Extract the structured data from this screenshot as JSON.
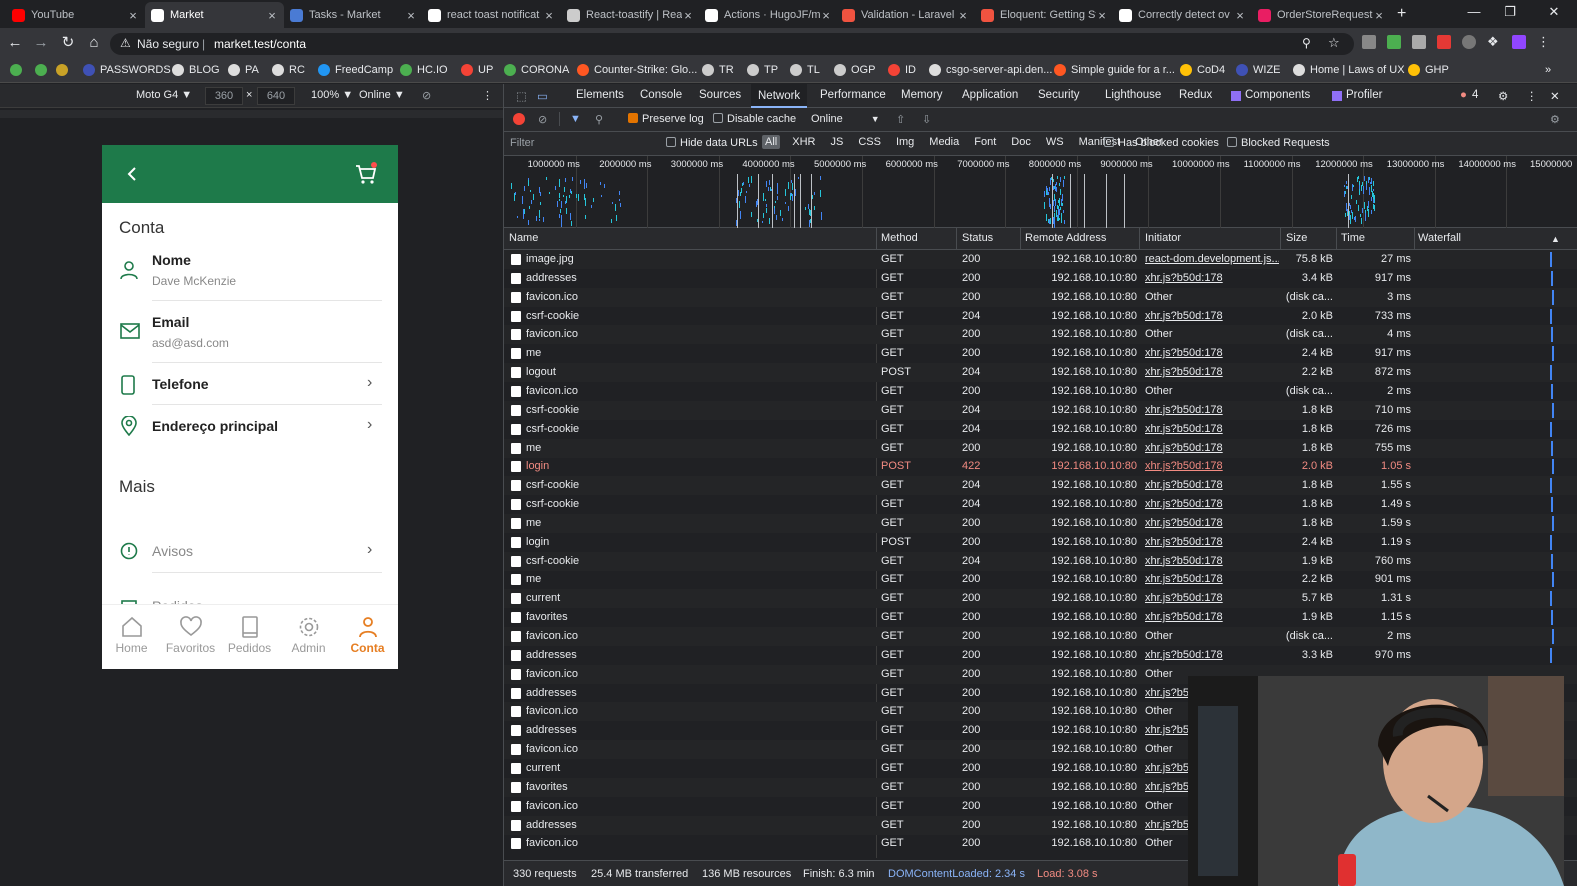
{
  "browser": {
    "tabs": [
      {
        "title": "YouTube",
        "color": "#ff0000"
      },
      {
        "title": "Market",
        "color": "#ffffff",
        "active": true
      },
      {
        "title": "Tasks - Market",
        "color": "#4a7bd4"
      },
      {
        "title": "react toast notificat",
        "color": "#ffffff"
      },
      {
        "title": "React-toastify | Rea",
        "color": "#cccccc"
      },
      {
        "title": "Actions · HugoJF/m",
        "color": "#ffffff"
      },
      {
        "title": "Validation - Laravel",
        "color": "#f05340"
      },
      {
        "title": "Eloquent: Getting St",
        "color": "#f05340"
      },
      {
        "title": "Correctly detect ov",
        "color": "#ffffff"
      },
      {
        "title": "OrderStoreRequest",
        "color": "#e91e63"
      }
    ],
    "security_label": "Não seguro",
    "url": "market.test/conta",
    "bookmarks": [
      {
        "label": "",
        "color": "#4caf50"
      },
      {
        "label": "",
        "color": "#4caf50"
      },
      {
        "label": "",
        "color": "#c9a227"
      },
      {
        "label": "PASSWORDS",
        "color": "#3f51b5"
      },
      {
        "label": "BLOG",
        "color": "#dddddd"
      },
      {
        "label": "PA",
        "color": "#dddddd"
      },
      {
        "label": "RC",
        "color": "#dddddd"
      },
      {
        "label": "FreedCamp",
        "color": "#2196f3"
      },
      {
        "label": "HC.IO",
        "color": "#4caf50"
      },
      {
        "label": "UP",
        "color": "#f44336"
      },
      {
        "label": "CORONA",
        "color": "#4caf50"
      },
      {
        "label": "Counter-Strike: Glo...",
        "color": "#ff5722"
      },
      {
        "label": "TR",
        "color": "#cccccc"
      },
      {
        "label": "TP",
        "color": "#cccccc"
      },
      {
        "label": "TL",
        "color": "#cccccc"
      },
      {
        "label": "OGP",
        "color": "#cccccc"
      },
      {
        "label": "ID",
        "color": "#f44336"
      },
      {
        "label": "csgo-server-api.den...",
        "color": "#dddddd"
      },
      {
        "label": "Simple guide for a r...",
        "color": "#ff5722"
      },
      {
        "label": "CoD4",
        "color": "#ffc107"
      },
      {
        "label": "WIZE",
        "color": "#3f51b5"
      },
      {
        "label": "Home | Laws of UX",
        "color": "#dddddd"
      },
      {
        "label": "GHP",
        "color": "#ffc107"
      }
    ]
  },
  "device_toolbar": {
    "device": "Moto G4 ▼",
    "width": "360",
    "times": "×",
    "height": "640",
    "zoom": "100% ▼",
    "network": "Online ▼"
  },
  "app": {
    "section_title": "Conta",
    "items": [
      {
        "label": "Nome",
        "sub": "Dave McKenzie",
        "icon": "user-icon"
      },
      {
        "label": "Email",
        "sub": "asd@asd.com",
        "icon": "mail-icon"
      },
      {
        "label": "Telefone",
        "icon": "phone-icon"
      },
      {
        "label": "Endereço principal",
        "icon": "map-pin-icon"
      }
    ],
    "more_title": "Mais",
    "more_items": [
      {
        "label": "Avisos",
        "icon": "alert-circle-icon"
      },
      {
        "label": "Pedidos",
        "icon": "bag-icon"
      }
    ],
    "bottom_nav": [
      "Home",
      "Favoritos",
      "Pedidos",
      "Admin",
      "Conta"
    ],
    "accent": "#1e7a4a",
    "active_color": "#e67e22"
  },
  "devtools": {
    "tabs": [
      "Elements",
      "Console",
      "Sources",
      "Network",
      "Performance",
      "Memory",
      "Application",
      "Security",
      "Lighthouse",
      "Redux",
      "Components",
      "Profiler"
    ],
    "error_count": "4",
    "preserve_log": "Preserve log",
    "disable_cache": "Disable cache",
    "throttle": "Online",
    "filter_placeholder": "Filter",
    "hide_data_urls": "Hide data URLs",
    "types": [
      "All",
      "XHR",
      "JS",
      "CSS",
      "Img",
      "Media",
      "Font",
      "Doc",
      "WS",
      "Manifest",
      "Other"
    ],
    "has_blocked_cookies": "Has blocked cookies",
    "blocked_requests": "Blocked Requests",
    "timeline_ticks": [
      "1000000 ms",
      "2000000 ms",
      "3000000 ms",
      "4000000 ms",
      "5000000 ms",
      "6000000 ms",
      "7000000 ms",
      "8000000 ms",
      "9000000 ms",
      "10000000 ms",
      "11000000 ms",
      "12000000 ms",
      "13000000 ms",
      "14000000 ms",
      "15000000"
    ],
    "columns": [
      "Name",
      "Method",
      "Status",
      "Remote Address",
      "Initiator",
      "Size",
      "Time",
      "Waterfall"
    ],
    "rows": [
      {
        "name": "image.jpg",
        "method": "GET",
        "status": "200",
        "addr": "192.168.10.10:80",
        "init": "react-dom.development.js...",
        "size": "75.8 kB",
        "time": "27 ms"
      },
      {
        "name": "addresses",
        "method": "GET",
        "status": "200",
        "addr": "192.168.10.10:80",
        "init": "xhr.js?b50d:178",
        "size": "3.4 kB",
        "time": "917 ms"
      },
      {
        "name": "favicon.ico",
        "method": "GET",
        "status": "200",
        "addr": "192.168.10.10:80",
        "init": "Other",
        "size": "(disk ca...",
        "time": "3 ms"
      },
      {
        "name": "csrf-cookie",
        "method": "GET",
        "status": "204",
        "addr": "192.168.10.10:80",
        "init": "xhr.js?b50d:178",
        "size": "2.0 kB",
        "time": "733 ms"
      },
      {
        "name": "favicon.ico",
        "method": "GET",
        "status": "200",
        "addr": "192.168.10.10:80",
        "init": "Other",
        "size": "(disk ca...",
        "time": "4 ms"
      },
      {
        "name": "me",
        "method": "GET",
        "status": "200",
        "addr": "192.168.10.10:80",
        "init": "xhr.js?b50d:178",
        "size": "2.4 kB",
        "time": "917 ms"
      },
      {
        "name": "logout",
        "method": "POST",
        "status": "204",
        "addr": "192.168.10.10:80",
        "init": "xhr.js?b50d:178",
        "size": "2.2 kB",
        "time": "872 ms"
      },
      {
        "name": "favicon.ico",
        "method": "GET",
        "status": "200",
        "addr": "192.168.10.10:80",
        "init": "Other",
        "size": "(disk ca...",
        "time": "2 ms"
      },
      {
        "name": "csrf-cookie",
        "method": "GET",
        "status": "204",
        "addr": "192.168.10.10:80",
        "init": "xhr.js?b50d:178",
        "size": "1.8 kB",
        "time": "710 ms"
      },
      {
        "name": "csrf-cookie",
        "method": "GET",
        "status": "204",
        "addr": "192.168.10.10:80",
        "init": "xhr.js?b50d:178",
        "size": "1.8 kB",
        "time": "726 ms"
      },
      {
        "name": "me",
        "method": "GET",
        "status": "200",
        "addr": "192.168.10.10:80",
        "init": "xhr.js?b50d:178",
        "size": "1.8 kB",
        "time": "755 ms"
      },
      {
        "name": "login",
        "method": "POST",
        "status": "422",
        "addr": "192.168.10.10:80",
        "init": "xhr.js?b50d:178",
        "size": "2.0 kB",
        "time": "1.05 s",
        "error": true
      },
      {
        "name": "csrf-cookie",
        "method": "GET",
        "status": "204",
        "addr": "192.168.10.10:80",
        "init": "xhr.js?b50d:178",
        "size": "1.8 kB",
        "time": "1.55 s"
      },
      {
        "name": "csrf-cookie",
        "method": "GET",
        "status": "204",
        "addr": "192.168.10.10:80",
        "init": "xhr.js?b50d:178",
        "size": "1.8 kB",
        "time": "1.49 s"
      },
      {
        "name": "me",
        "method": "GET",
        "status": "200",
        "addr": "192.168.10.10:80",
        "init": "xhr.js?b50d:178",
        "size": "1.8 kB",
        "time": "1.59 s"
      },
      {
        "name": "login",
        "method": "POST",
        "status": "200",
        "addr": "192.168.10.10:80",
        "init": "xhr.js?b50d:178",
        "size": "2.4 kB",
        "time": "1.19 s"
      },
      {
        "name": "csrf-cookie",
        "method": "GET",
        "status": "204",
        "addr": "192.168.10.10:80",
        "init": "xhr.js?b50d:178",
        "size": "1.9 kB",
        "time": "760 ms"
      },
      {
        "name": "me",
        "method": "GET",
        "status": "200",
        "addr": "192.168.10.10:80",
        "init": "xhr.js?b50d:178",
        "size": "2.2 kB",
        "time": "901 ms"
      },
      {
        "name": "current",
        "method": "GET",
        "status": "200",
        "addr": "192.168.10.10:80",
        "init": "xhr.js?b50d:178",
        "size": "5.7 kB",
        "time": "1.31 s"
      },
      {
        "name": "favorites",
        "method": "GET",
        "status": "200",
        "addr": "192.168.10.10:80",
        "init": "xhr.js?b50d:178",
        "size": "1.9 kB",
        "time": "1.15 s"
      },
      {
        "name": "favicon.ico",
        "method": "GET",
        "status": "200",
        "addr": "192.168.10.10:80",
        "init": "Other",
        "size": "(disk ca...",
        "time": "2 ms"
      },
      {
        "name": "addresses",
        "method": "GET",
        "status": "200",
        "addr": "192.168.10.10:80",
        "init": "xhr.js?b50d:178",
        "size": "3.3 kB",
        "time": "970 ms"
      },
      {
        "name": "favicon.ico",
        "method": "GET",
        "status": "200",
        "addr": "192.168.10.10:80",
        "init": "Other",
        "size": "",
        "time": ""
      },
      {
        "name": "addresses",
        "method": "GET",
        "status": "200",
        "addr": "192.168.10.10:80",
        "init": "xhr.js?b5",
        "size": "",
        "time": ""
      },
      {
        "name": "favicon.ico",
        "method": "GET",
        "status": "200",
        "addr": "192.168.10.10:80",
        "init": "Other",
        "size": "",
        "time": ""
      },
      {
        "name": "addresses",
        "method": "GET",
        "status": "200",
        "addr": "192.168.10.10:80",
        "init": "xhr.js?b5",
        "size": "",
        "time": ""
      },
      {
        "name": "favicon.ico",
        "method": "GET",
        "status": "200",
        "addr": "192.168.10.10:80",
        "init": "Other",
        "size": "",
        "time": ""
      },
      {
        "name": "current",
        "method": "GET",
        "status": "200",
        "addr": "192.168.10.10:80",
        "init": "xhr.js?b5",
        "size": "",
        "time": ""
      },
      {
        "name": "favorites",
        "method": "GET",
        "status": "200",
        "addr": "192.168.10.10:80",
        "init": "xhr.js?b5",
        "size": "",
        "time": ""
      },
      {
        "name": "favicon.ico",
        "method": "GET",
        "status": "200",
        "addr": "192.168.10.10:80",
        "init": "Other",
        "size": "",
        "time": ""
      },
      {
        "name": "addresses",
        "method": "GET",
        "status": "200",
        "addr": "192.168.10.10:80",
        "init": "xhr.js?b5",
        "size": "",
        "time": ""
      },
      {
        "name": "favicon.ico",
        "method": "GET",
        "status": "200",
        "addr": "192.168.10.10:80",
        "init": "Other",
        "size": "",
        "time": ""
      }
    ],
    "status": {
      "requests": "330 requests",
      "transferred": "25.4 MB transferred",
      "resources": "136 MB resources",
      "finish": "Finish: 6.3 min",
      "dcl": "DOMContentLoaded: 2.34 s",
      "load": "Load: 3.08 s"
    }
  }
}
